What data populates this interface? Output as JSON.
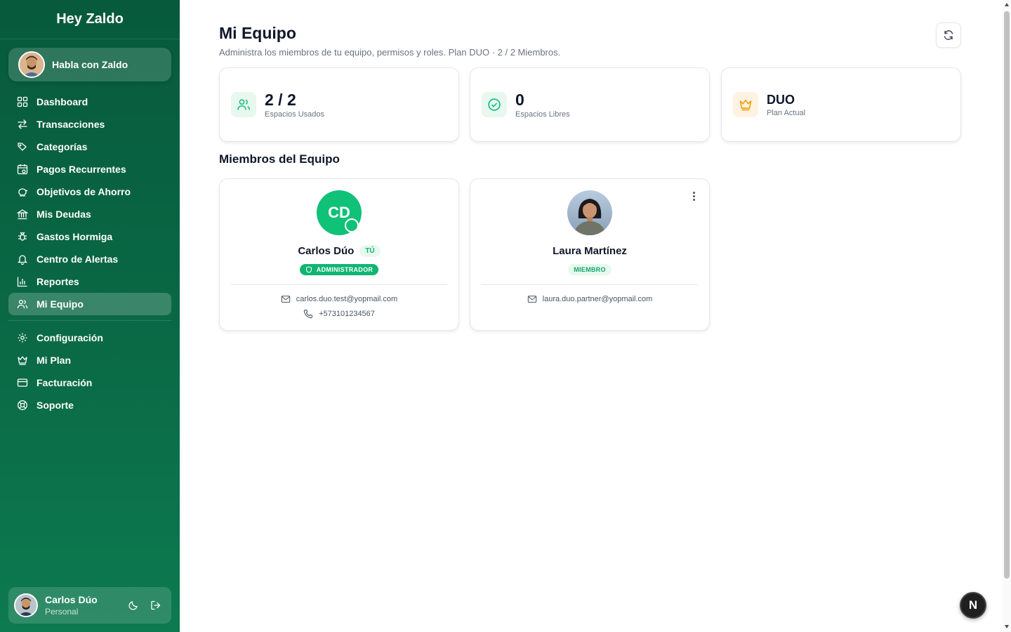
{
  "sidebar": {
    "brand": "Hey Zaldo",
    "chat_label": "Habla con Zaldo",
    "items": [
      {
        "label": "Dashboard",
        "icon": "dashboard-icon"
      },
      {
        "label": "Transacciones",
        "icon": "arrows-icon"
      },
      {
        "label": "Categorías",
        "icon": "tags-icon"
      },
      {
        "label": "Pagos Recurrentes",
        "icon": "calendar-icon"
      },
      {
        "label": "Objetivos de Ahorro",
        "icon": "piggy-bank-icon"
      },
      {
        "label": "Mis Deudas",
        "icon": "bank-icon"
      },
      {
        "label": "Gastos Hormiga",
        "icon": "bug-icon"
      },
      {
        "label": "Centro de Alertas",
        "icon": "bell-icon"
      },
      {
        "label": "Reportes",
        "icon": "chart-icon"
      },
      {
        "label": "Mi Equipo",
        "icon": "users-icon",
        "active": true
      }
    ],
    "secondary_items": [
      {
        "label": "Configuración",
        "icon": "gear-icon"
      },
      {
        "label": "Mi Plan",
        "icon": "crown-icon"
      },
      {
        "label": "Facturación",
        "icon": "credit-card-icon"
      },
      {
        "label": "Soporte",
        "icon": "lifebuoy-icon"
      }
    ],
    "user": {
      "name": "Carlos Dúo",
      "plan": "Personal"
    }
  },
  "main": {
    "title": "Mi Equipo",
    "subtitle": "Administra los miembros de tu equipo, permisos y roles. Plan DUO · 2 / 2 Miembros.",
    "stats": [
      {
        "value": "2 / 2",
        "label": "Espacios Usados",
        "icon": "users-icon",
        "color": "#10b981"
      },
      {
        "value": "0",
        "label": "Espacios Libres",
        "icon": "check-circle-icon",
        "color": "#10b981"
      },
      {
        "value": "DUO",
        "label": "Plan Actual",
        "icon": "crown-icon",
        "color": "#f59e0b"
      }
    ],
    "members_title": "Miembros del Equipo",
    "members": [
      {
        "initials": "CD",
        "name": "Carlos Dúo",
        "you_badge": "TÚ",
        "role": "ADMINISTRADOR",
        "email": "carlos.duo.test@yopmail.com",
        "phone": "+573101234567"
      },
      {
        "name": "Laura Martínez",
        "role": "MIEMBRO",
        "email": "laura.duo.partner@yopmail.com"
      }
    ]
  },
  "floating_badge": "N",
  "colors": {
    "sidebar": "#0a6a46",
    "accent": "#10c178",
    "crown": "#f59e0b"
  }
}
